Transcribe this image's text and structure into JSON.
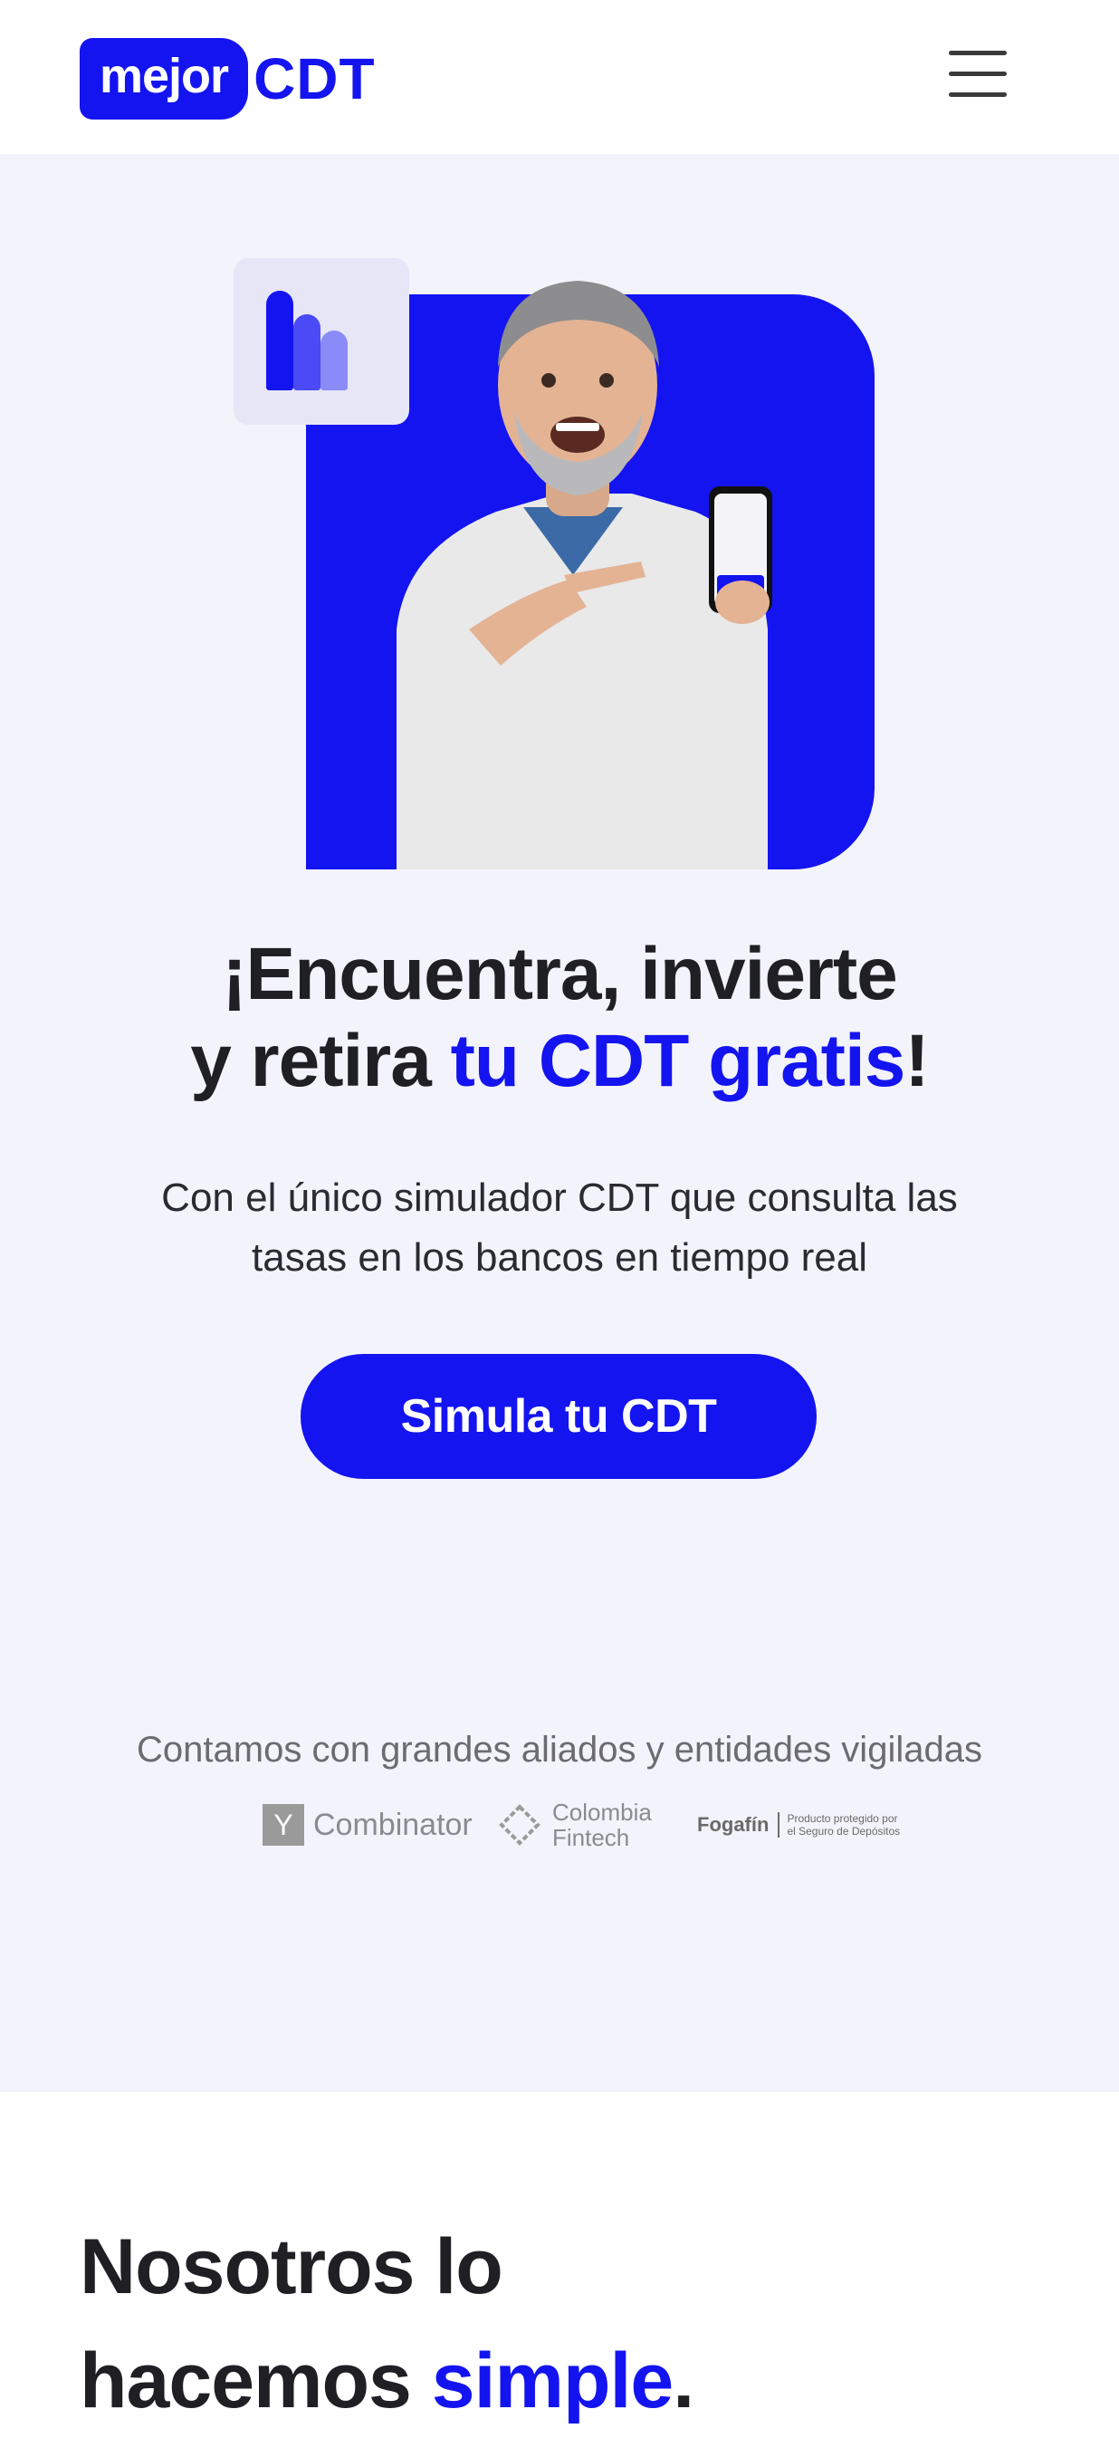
{
  "header": {
    "logo_word": "mejor",
    "logo_cdt": "CDT",
    "menu_icon": "hamburger-menu-icon"
  },
  "hero": {
    "headline_line1": "¡Encuentra, invierte",
    "headline_line2_start": "y retira ",
    "headline_line2_accent": "tu CDT gratis",
    "headline_line2_end": "!",
    "subtitle": "Con el único simulador CDT que consulta las tasas en los bancos en tiempo real",
    "cta_label": "Simula tu CDT",
    "accent_color": "#1414f0"
  },
  "partners": {
    "title": "Contamos con grandes aliados y entidades vigiladas",
    "items": [
      {
        "mark": "Y",
        "name": "Combinator"
      },
      {
        "name_line1": "Colombia",
        "name_line2": "Fintech"
      },
      {
        "name": "Fogafín",
        "tagline_line1": "Producto protegido por",
        "tagline_line2": "el Seguro de Depósitos"
      }
    ]
  },
  "carousel": {
    "active_index": 0,
    "count": 3
  },
  "section2": {
    "title_line1": "Nosotros lo",
    "title_line2_start": "hacemos ",
    "title_line2_accent": "simple",
    "title_line2_end": "."
  }
}
